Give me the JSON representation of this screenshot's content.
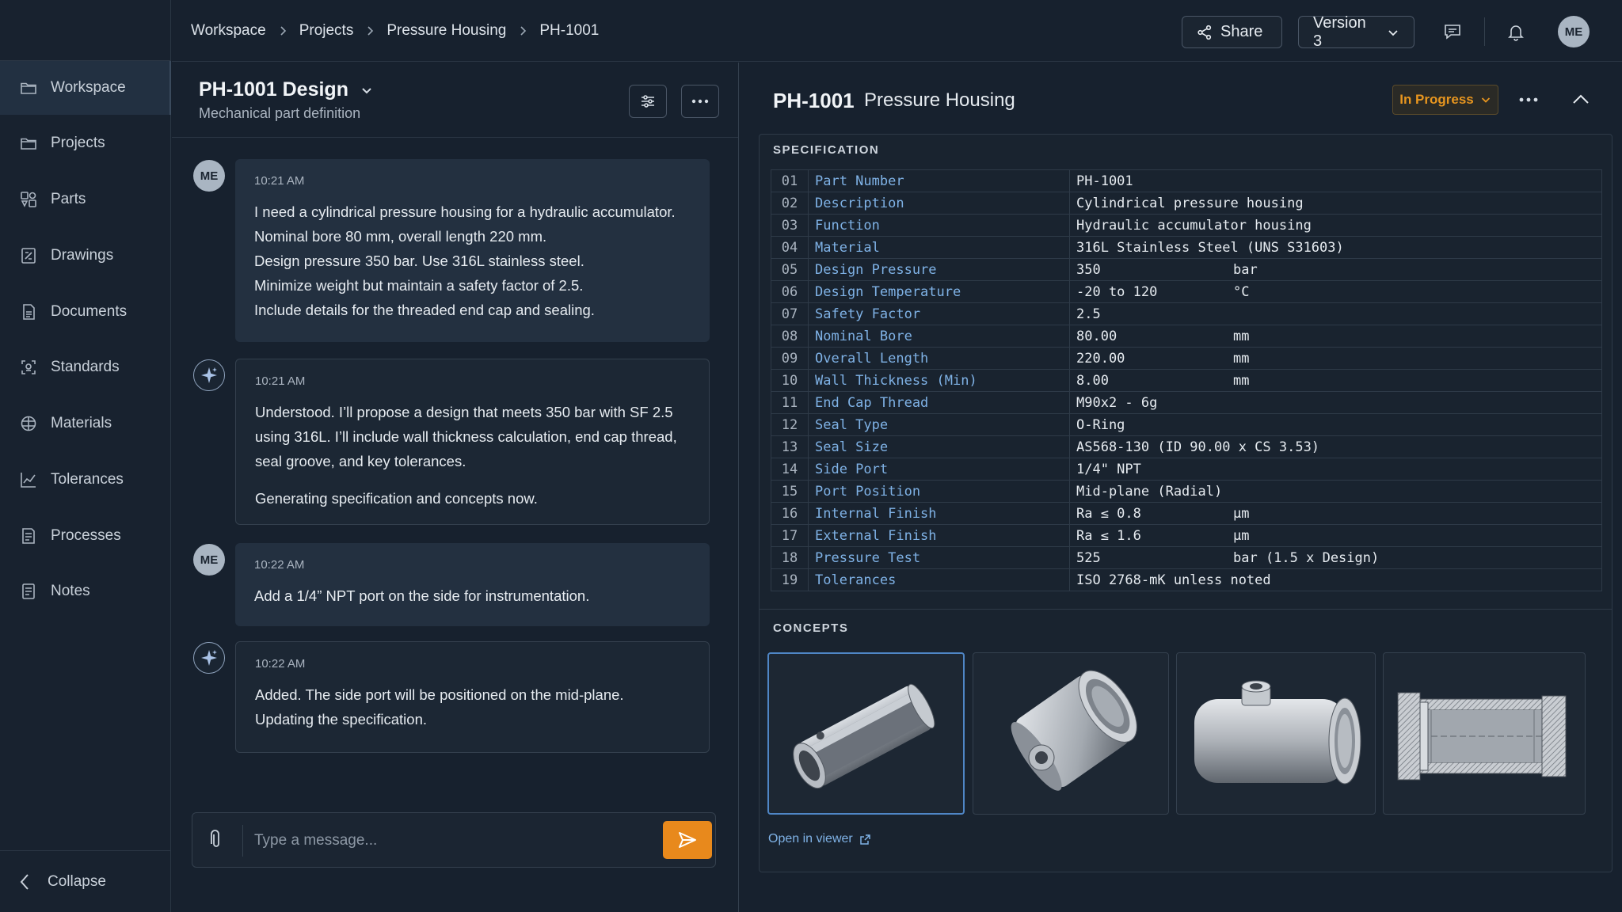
{
  "breadcrumb": [
    "Workspace",
    "Projects",
    "Pressure Housing",
    "PH-1001"
  ],
  "topbar": {
    "share_label": "Share",
    "version_label": "Version 3",
    "user_initials": "ME"
  },
  "sidebar": {
    "items": [
      {
        "label": "Workspace",
        "icon": "folder-icon",
        "active": true
      },
      {
        "label": "Projects",
        "icon": "folder-icon"
      },
      {
        "label": "Parts",
        "icon": "parts-icon"
      },
      {
        "label": "Drawings",
        "icon": "drawing-icon"
      },
      {
        "label": "Documents",
        "icon": "document-icon"
      },
      {
        "label": "Standards",
        "icon": "standards-icon"
      },
      {
        "label": "Materials",
        "icon": "materials-icon"
      },
      {
        "label": "Tolerances",
        "icon": "chart-icon"
      },
      {
        "label": "Processes",
        "icon": "process-icon"
      },
      {
        "label": "Notes",
        "icon": "notes-icon"
      }
    ],
    "collapse_label": "Collapse"
  },
  "chat": {
    "title": "PH-1001 Design",
    "subtitle": "Mechanical part definition",
    "messages": [
      {
        "role": "me",
        "avatar": "ME",
        "time": "10:21 AM",
        "lines": [
          "I need a cylindrical pressure housing for a hydraulic accumulator.",
          "Nominal bore 80 mm, overall length 220 mm.",
          "Design pressure 350 bar. Use 316L stainless steel.",
          "Minimize weight but maintain a safety factor of 2.5.",
          "Include details for the threaded end cap and sealing."
        ]
      },
      {
        "role": "ai",
        "time": "10:21 AM",
        "lines": [
          "Understood. I’ll propose a design that meets 350 bar with SF 2.5",
          "using 316L. I’ll include wall thickness calculation, end cap thread,",
          "seal groove, and key tolerances."
        ],
        "followup": "Generating specification and concepts now."
      },
      {
        "role": "me",
        "avatar": "ME",
        "time": "10:22 AM",
        "lines": [
          "Add a 1/4” NPT port on the side for instrumentation."
        ]
      },
      {
        "role": "ai",
        "time": "10:22 AM",
        "lines": [
          "Added. The side port will be positioned on the mid-plane.",
          "Updating the specification."
        ]
      }
    ],
    "input_placeholder": "Type a message..."
  },
  "part": {
    "id": "PH-1001",
    "name": "Pressure Housing",
    "status": "In Progress",
    "status_color": "#e8961f",
    "spec_label": "SPECIFICATION",
    "spec": [
      {
        "n": "01",
        "k": "Part Number",
        "v": "PH-1001",
        "u": ""
      },
      {
        "n": "02",
        "k": "Description",
        "v": "Cylindrical pressure housing",
        "u": ""
      },
      {
        "n": "03",
        "k": "Function",
        "v": "Hydraulic accumulator housing",
        "u": ""
      },
      {
        "n": "04",
        "k": "Material",
        "v": "316L Stainless Steel (UNS S31603)",
        "u": ""
      },
      {
        "n": "05",
        "k": "Design Pressure",
        "v": "350",
        "u": "bar"
      },
      {
        "n": "06",
        "k": "Design Temperature",
        "v": "-20 to 120",
        "u": "°C"
      },
      {
        "n": "07",
        "k": "Safety Factor",
        "v": "2.5",
        "u": ""
      },
      {
        "n": "08",
        "k": "Nominal Bore",
        "v": "80.00",
        "u": "mm"
      },
      {
        "n": "09",
        "k": "Overall Length",
        "v": "220.00",
        "u": "mm"
      },
      {
        "n": "10",
        "k": "Wall Thickness (Min)",
        "v": "8.00",
        "u": "mm"
      },
      {
        "n": "11",
        "k": "End Cap Thread",
        "v": "M90x2 - 6g",
        "u": ""
      },
      {
        "n": "12",
        "k": "Seal Type",
        "v": "O-Ring",
        "u": ""
      },
      {
        "n": "13",
        "k": "Seal Size",
        "v": "AS568-130 (ID 90.00 x CS 3.53)",
        "u": ""
      },
      {
        "n": "14",
        "k": "Side Port",
        "v": "1/4\" NPT",
        "u": ""
      },
      {
        "n": "15",
        "k": "Port Position",
        "v": "Mid-plane (Radial)",
        "u": ""
      },
      {
        "n": "16",
        "k": "Internal Finish",
        "v": "Ra ≤ 0.8",
        "u": "µm"
      },
      {
        "n": "17",
        "k": "External Finish",
        "v": "Ra ≤ 1.6",
        "u": "µm"
      },
      {
        "n": "18",
        "k": "Pressure Test",
        "v": "525",
        "u": "bar (1.5 x Design)"
      },
      {
        "n": "19",
        "k": "Tolerances",
        "v": "ISO 2768-mK unless noted",
        "u": ""
      }
    ],
    "concepts_label": "CONCEPTS",
    "open_viewer_label": "Open in viewer"
  }
}
